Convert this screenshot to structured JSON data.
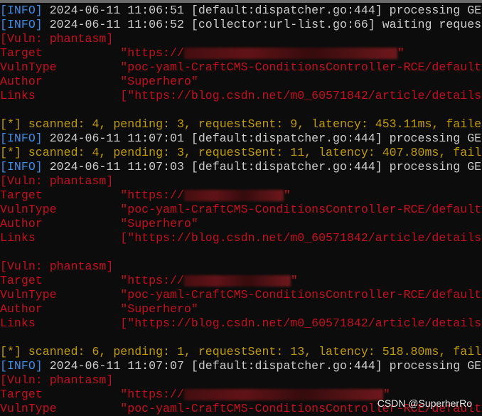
{
  "colors": {
    "info": "#3b8eea",
    "text": "#cccccc",
    "status": "#c19c00",
    "vuln": "#c50f1f"
  },
  "lines": [
    [
      {
        "t": "[INFO]",
        "c": "info"
      },
      {
        "t": " 2024-06-11 11:06:51 [default:dispatcher.go:444] processing GE",
        "c": "text"
      }
    ],
    [
      {
        "t": "[INFO]",
        "c": "info"
      },
      {
        "t": " 2024-06-11 11:06:52 [collector:url-list.go:66] waiting reques",
        "c": "text"
      }
    ],
    [
      {
        "t": "[Vuln: phantasm]",
        "c": "vuln"
      }
    ],
    [
      {
        "t": "Target           \"https://",
        "c": "vuln"
      },
      {
        "r": 300
      },
      {
        "t": "\"",
        "c": "vuln"
      }
    ],
    [
      {
        "t": "VulnType         \"poc-yaml-CraftCMS-ConditionsController-RCE/default",
        "c": "vuln"
      }
    ],
    [
      {
        "t": "Author           \"Superhero\"",
        "c": "vuln"
      }
    ],
    [
      {
        "t": "Links            [\"https://blog.csdn.net/m0_60571842/article/details",
        "c": "vuln"
      }
    ],
    [],
    [
      {
        "t": "[*] scanned: 4, pending: 3, requestSent: 9, latency: 453.11ms, faile",
        "c": "status"
      }
    ],
    [
      {
        "t": "[INFO]",
        "c": "info"
      },
      {
        "t": " 2024-06-11 11:07:01 [default:dispatcher.go:444] processing GE",
        "c": "text"
      }
    ],
    [
      {
        "t": "[*] scanned: 4, pending: 3, requestSent: 11, latency: 407.80ms, fail",
        "c": "status"
      }
    ],
    [
      {
        "t": "[INFO]",
        "c": "info"
      },
      {
        "t": " 2024-06-11 11:07:03 [default:dispatcher.go:444] processing GE",
        "c": "text"
      }
    ],
    [
      {
        "t": "[Vuln: phantasm]",
        "c": "vuln"
      }
    ],
    [
      {
        "t": "Target           \"https://",
        "c": "vuln"
      },
      {
        "r": 140
      },
      {
        "t": "\"",
        "c": "vuln"
      }
    ],
    [
      {
        "t": "VulnType         \"poc-yaml-CraftCMS-ConditionsController-RCE/default",
        "c": "vuln"
      }
    ],
    [
      {
        "t": "Author           \"Superhero\"",
        "c": "vuln"
      }
    ],
    [
      {
        "t": "Links            [\"https://blog.csdn.net/m0_60571842/article/details",
        "c": "vuln"
      }
    ],
    [],
    [
      {
        "t": "[Vuln: phantasm]",
        "c": "vuln"
      }
    ],
    [
      {
        "t": "Target           \"https://",
        "c": "vuln"
      },
      {
        "r": 150
      },
      {
        "t": "\"",
        "c": "vuln"
      }
    ],
    [
      {
        "t": "VulnType         \"poc-yaml-CraftCMS-ConditionsController-RCE/default",
        "c": "vuln"
      }
    ],
    [
      {
        "t": "Author           \"Superhero\"",
        "c": "vuln"
      }
    ],
    [
      {
        "t": "Links            [\"https://blog.csdn.net/m0_60571842/article/details",
        "c": "vuln"
      }
    ],
    [],
    [
      {
        "t": "[*] scanned: 6, pending: 1, requestSent: 13, latency: 518.80ms, fail",
        "c": "status"
      }
    ],
    [
      {
        "t": "[INFO]",
        "c": "info"
      },
      {
        "t": " 2024-06-11 11:07:07 [default:dispatcher.go:444] processing GE",
        "c": "text"
      }
    ],
    [
      {
        "t": "[Vuln: phantasm]",
        "c": "vuln"
      }
    ],
    [
      {
        "t": "Target           \"https://",
        "c": "vuln"
      },
      {
        "r": 280
      },
      {
        "t": "\"",
        "c": "vuln"
      }
    ],
    [
      {
        "t": "VulnType         \"poc-yaml-CraftCMS-ConditionsController-RCE/default",
        "c": "vuln"
      }
    ]
  ],
  "watermark": "CSDN @SuperherRo"
}
